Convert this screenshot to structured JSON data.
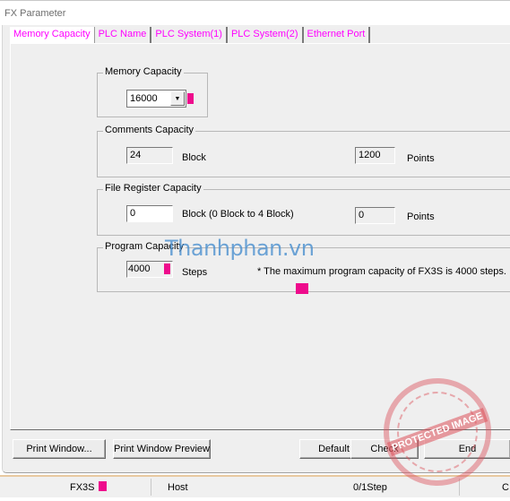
{
  "window": {
    "title": "FX Parameter"
  },
  "tabs": [
    {
      "label": "Memory Capacity",
      "active": true
    },
    {
      "label": "PLC Name",
      "active": false
    },
    {
      "label": "PLC System(1)",
      "active": false
    },
    {
      "label": "PLC System(2)",
      "active": false
    },
    {
      "label": "Ethernet Port",
      "active": false
    }
  ],
  "memory_capacity": {
    "group_label": "Memory Capacity",
    "value": "16000"
  },
  "comments_capacity": {
    "group_label": "Comments Capacity",
    "block_value": "24",
    "block_unit": "Block",
    "points_value": "1200",
    "points_unit": "Points"
  },
  "file_register_capacity": {
    "group_label": "File Register Capacity",
    "block_value": "0",
    "block_unit": "Block (0 Block to 4 Block)",
    "points_value": "0",
    "points_unit": "Points"
  },
  "program_capacity": {
    "group_label": "Program Capacity",
    "steps_value": "4000",
    "steps_unit": "Steps",
    "note": "* The maximum program capacity of FX3S is 4000 steps."
  },
  "buttons": {
    "print_window": "Print Window...",
    "print_window_preview": "Print Window Preview",
    "default": "Default",
    "check": "Check",
    "end": "End"
  },
  "statusbar": {
    "plc_type": "FX3S",
    "connection": "Host",
    "steps": "0/1Step",
    "extra": "C"
  },
  "overlays": {
    "watermark_text": "Thanhphan.vn",
    "stamp_text": "PROTECTED IMAGE"
  },
  "colors": {
    "tab_text": "#ff00ff",
    "marker": "#ee0b8c",
    "watermark": "#4a8fcf"
  }
}
